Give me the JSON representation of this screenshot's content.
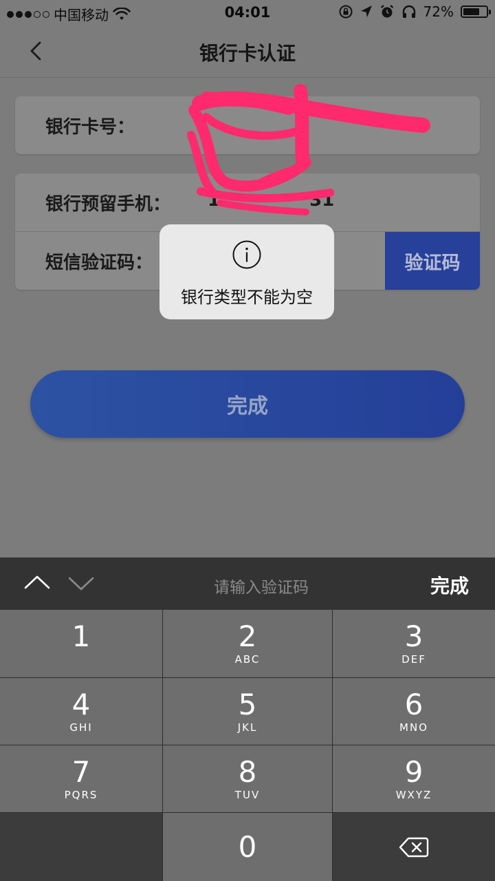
{
  "status_bar": {
    "carrier": "中国移动",
    "time": "04:01",
    "battery_percent": "72%",
    "battery_level": 0.72,
    "icons": [
      "signal-dots",
      "wifi-icon",
      "orientation-lock-icon",
      "location-icon",
      "alarm-icon",
      "headphones-icon",
      "battery-icon"
    ]
  },
  "nav": {
    "title": "银行卡认证",
    "back_icon": "chevron-left-icon"
  },
  "form": {
    "card_number": {
      "label": "银行卡号：",
      "value": ""
    },
    "phone": {
      "label": "银行预留手机：",
      "value": "1     31"
    },
    "sms_code": {
      "label": "短信验证码：",
      "value": "",
      "button_label": "验证码"
    }
  },
  "toast": {
    "icon": "info-circle-icon",
    "message": "银行类型不能为空"
  },
  "done_button": {
    "label": "完成"
  },
  "keyboard": {
    "accessory": {
      "placeholder": "请输入验证码",
      "done_label": "完成",
      "icons": [
        "chevron-up-icon",
        "chevron-down-icon"
      ]
    },
    "keys": [
      {
        "num": "1",
        "letters": ""
      },
      {
        "num": "2",
        "letters": "ABC"
      },
      {
        "num": "3",
        "letters": "DEF"
      },
      {
        "num": "4",
        "letters": "GHI"
      },
      {
        "num": "5",
        "letters": "JKL"
      },
      {
        "num": "6",
        "letters": "MNO"
      },
      {
        "num": "7",
        "letters": "PQRS"
      },
      {
        "num": "8",
        "letters": "TUV"
      },
      {
        "num": "9",
        "letters": "WXYZ"
      },
      {
        "num": "0",
        "letters": ""
      }
    ],
    "delete_icon": "backspace-icon"
  },
  "colors": {
    "accent_blue": "#2b4aa0",
    "redaction_pink": "#ff2a6d"
  }
}
